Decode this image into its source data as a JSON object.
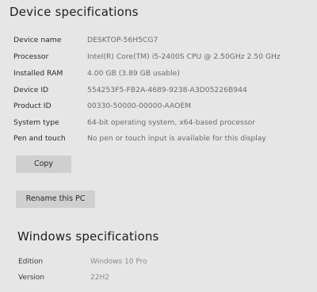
{
  "device": {
    "title": "Device specifications",
    "rows": [
      {
        "label": "Device name",
        "value": "DESKTOP-56H5CG7"
      },
      {
        "label": "Processor",
        "value": "Intel(R) Core(TM) i5-2400S CPU @ 2.50GHz   2.50 GHz"
      },
      {
        "label": "Installed RAM",
        "value": "4.00 GB (3.89 GB usable)"
      },
      {
        "label": "Device ID",
        "value": "554253F5-FB2A-4689-9238-A3D05226B944"
      },
      {
        "label": "Product ID",
        "value": "00330-50000-00000-AAOEM"
      },
      {
        "label": "System type",
        "value": "64-bit operating system, x64-based processor"
      },
      {
        "label": "Pen and touch",
        "value": "No pen or touch input is available for this display"
      }
    ],
    "copy_label": "Copy",
    "rename_label": "Rename this PC"
  },
  "windows": {
    "title": "Windows specifications",
    "rows": [
      {
        "label": "Edition",
        "value": "Windows 10 Pro"
      },
      {
        "label": "Version",
        "value": "22H2"
      }
    ]
  }
}
